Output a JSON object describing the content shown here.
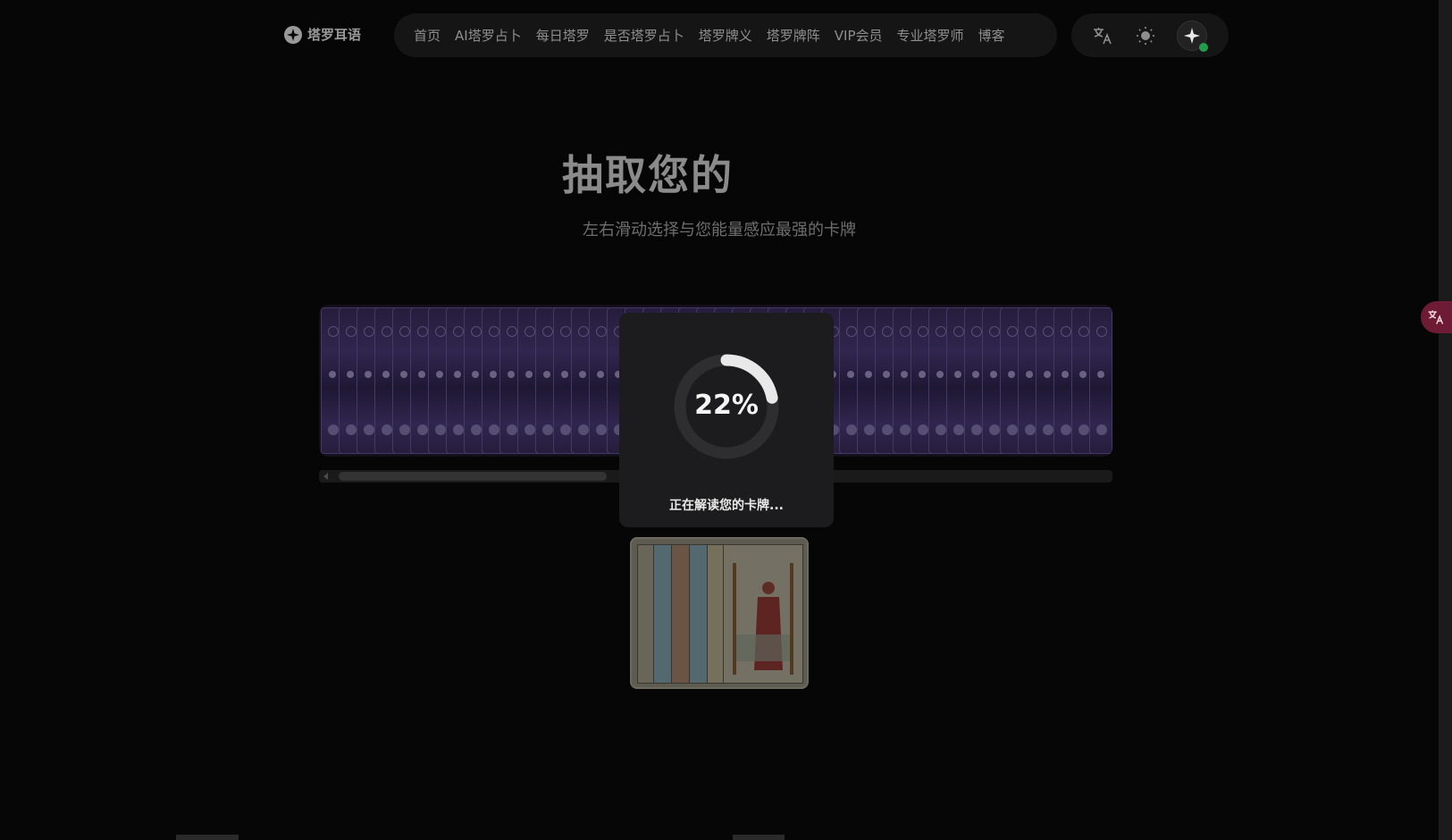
{
  "header": {
    "logo_text": "塔罗耳语",
    "nav": [
      {
        "label": "首页"
      },
      {
        "label": "AI塔罗占卜"
      },
      {
        "label": "每日塔罗"
      },
      {
        "label": "是否塔罗占卜"
      },
      {
        "label": "塔罗牌义"
      },
      {
        "label": "塔罗牌阵"
      },
      {
        "label": "VIP会员"
      },
      {
        "label": "专业塔罗师"
      },
      {
        "label": "博客"
      }
    ],
    "tools": {
      "translate_icon": "translate-icon",
      "theme_icon": "sun-icon",
      "ai_icon": "sparkle-icon",
      "status_color": "#1f9d4b"
    }
  },
  "hero": {
    "title": "抽取您的",
    "subtitle": "左右滑动选择与您能量感应最强的卡牌"
  },
  "progress": {
    "value": 0.22,
    "label": "22%",
    "status_text": "正在解读您的卡牌..."
  },
  "colors": {
    "background": "#060606",
    "deck_purple": "#4b3a7b",
    "float_button": "#6e1b35"
  }
}
